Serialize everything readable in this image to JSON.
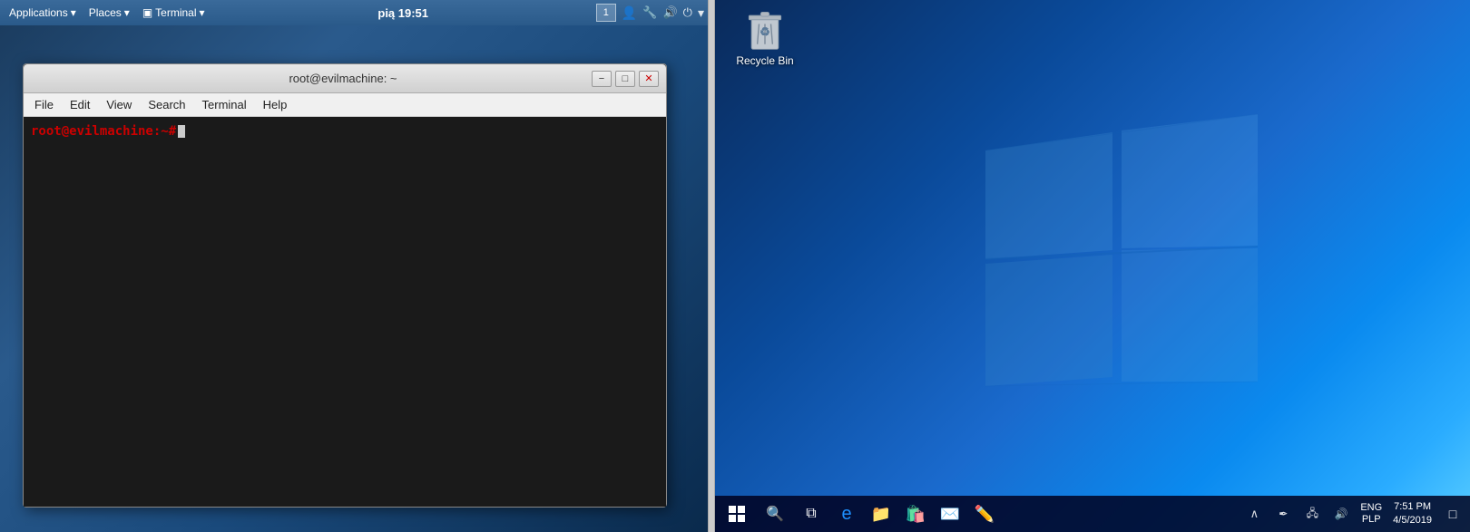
{
  "kali": {
    "taskbar": {
      "applications_label": "Applications",
      "places_label": "Places",
      "terminal_label": "Terminal",
      "time": "pią 19:51",
      "workspace_num": "1"
    },
    "terminal": {
      "title": "root@evilmachine: ~",
      "menu_items": [
        "File",
        "Edit",
        "View",
        "Search",
        "Terminal",
        "Help"
      ],
      "prompt_user": "root@evilmachine:",
      "prompt_symbol": "~#"
    }
  },
  "windows": {
    "desktop": {
      "recycle_bin_label": "Recycle Bin"
    },
    "taskbar": {
      "language": "ENG",
      "language_sub": "PLP",
      "time": "7:51 PM",
      "date": "4/5/2019"
    }
  }
}
